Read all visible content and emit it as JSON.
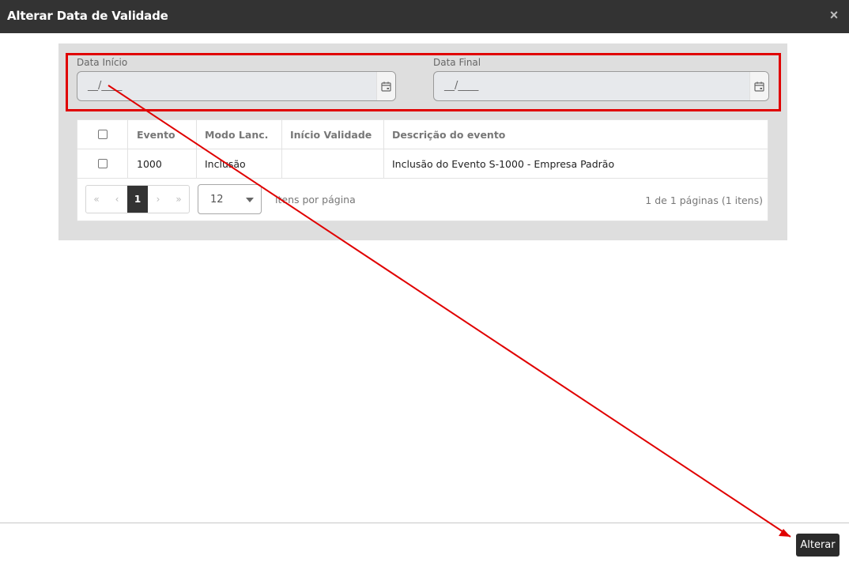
{
  "window": {
    "title": "Alterar Data de Validade"
  },
  "dates": {
    "start": {
      "label": "Data Início",
      "value": "__/____"
    },
    "end": {
      "label": "Data Final",
      "value": "__/____"
    }
  },
  "table": {
    "headers": [
      "",
      "Evento",
      "Modo Lanc.",
      "Início Validade",
      "Descrição do evento"
    ],
    "rows": [
      {
        "evento": "1000",
        "modo": "Inclusão",
        "inicio": "",
        "descricao": "Inclusão do Evento S-1000 - Empresa Padrão"
      }
    ]
  },
  "pagination": {
    "first": "«",
    "prev": "‹",
    "current": "1",
    "next": "›",
    "last": "»",
    "page_size": "12",
    "per_page_label": "itens por página",
    "info": "1 de 1 páginas (1 itens)"
  },
  "footer": {
    "submit_label": "Alterar"
  },
  "annotation": {
    "color": "#e00000"
  }
}
